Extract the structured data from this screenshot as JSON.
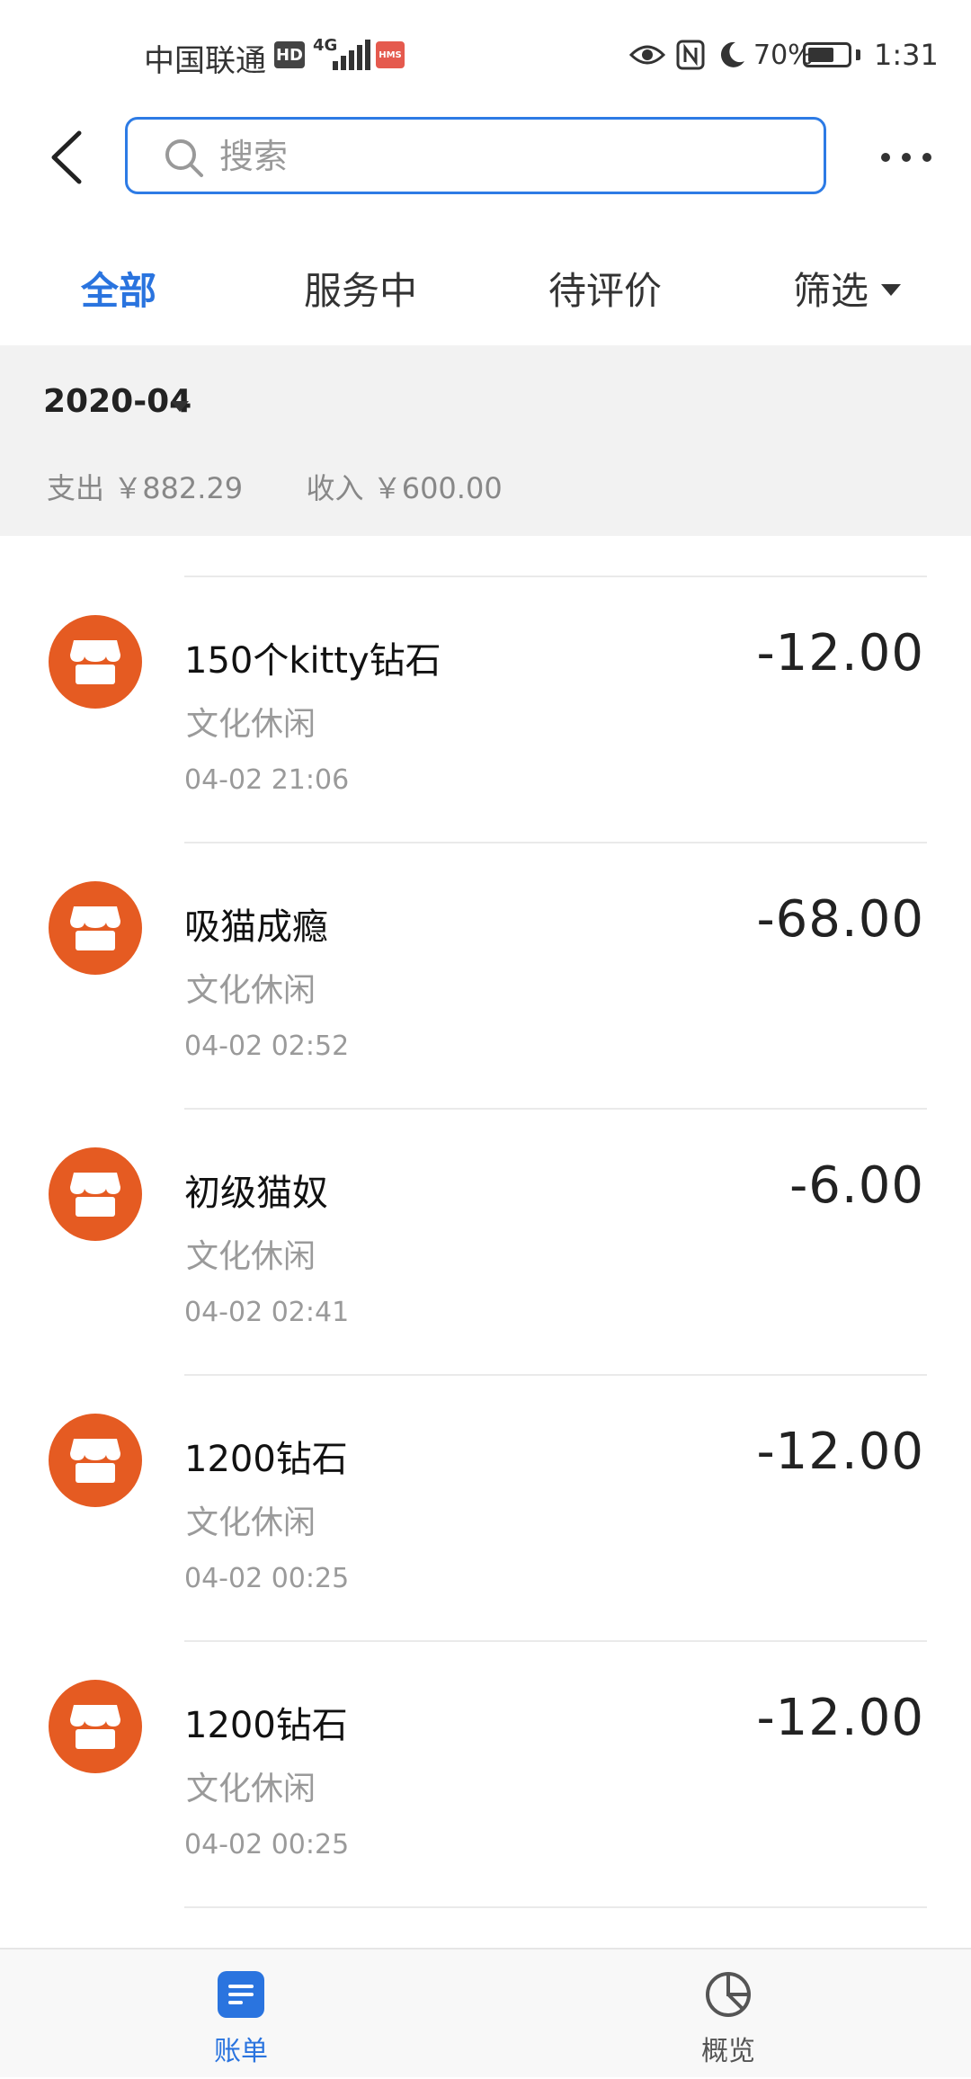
{
  "status_bar": {
    "carrier": "中国联通",
    "hd_badge": "HD",
    "network": "4G",
    "hms_badge": "HMS",
    "battery": "70%",
    "time": "1:31"
  },
  "search": {
    "placeholder": "搜索"
  },
  "tabs": [
    {
      "label": "全部",
      "active": true
    },
    {
      "label": "服务中",
      "active": false
    },
    {
      "label": "待评价",
      "active": false
    },
    {
      "label": "筛选",
      "active": false
    }
  ],
  "month": {
    "label": "2020-04",
    "expense_label": "支出",
    "expense_value": "￥882.29",
    "income_label": "收入",
    "income_value": "￥600.00"
  },
  "transactions": [
    {
      "title": "150个kitty钻石",
      "category": "文化休闲",
      "time": "04-02  21:06",
      "amount": "-12.00"
    },
    {
      "title": "吸猫成瘾",
      "category": "文化休闲",
      "time": "04-02  02:52",
      "amount": "-68.00"
    },
    {
      "title": "初级猫奴",
      "category": "文化休闲",
      "time": "04-02  02:41",
      "amount": "-6.00"
    },
    {
      "title": "1200钻石",
      "category": "文化休闲",
      "time": "04-02  00:25",
      "amount": "-12.00"
    },
    {
      "title": "1200钻石",
      "category": "文化休闲",
      "time": "04-02  00:25",
      "amount": "-12.00"
    }
  ],
  "bottom_nav": [
    {
      "label": "账单",
      "icon": "bill-icon",
      "active": true
    },
    {
      "label": "概览",
      "icon": "pie-chart-icon",
      "active": false
    }
  ],
  "colors": {
    "accent": "#2a74df",
    "merchant_logo": "#e55b22",
    "summary_bg": "#f2f2f2"
  }
}
